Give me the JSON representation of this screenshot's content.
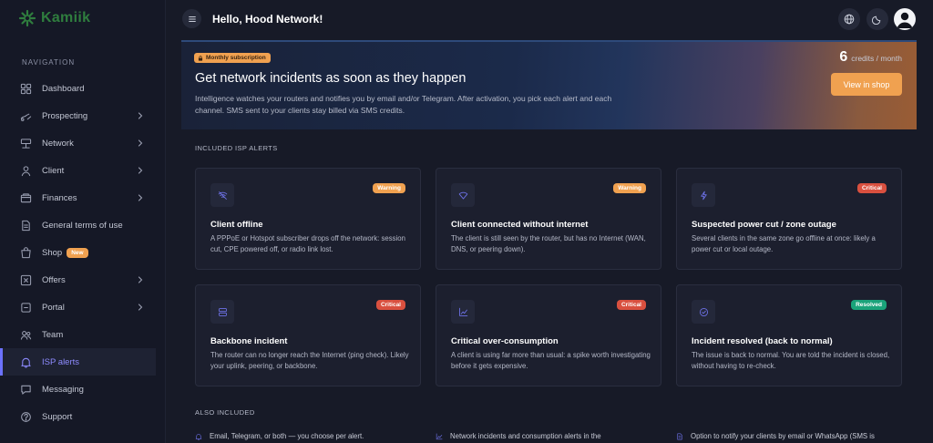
{
  "app": {
    "name": "Kamiik",
    "brand_color": "#2f7d3e",
    "accent": "#6c72ff"
  },
  "header": {
    "greeting": "Hello, Hood Network!"
  },
  "sidebar": {
    "heading": "NAVIGATION",
    "items": [
      {
        "label": "Dashboard",
        "icon": "dashboard-icon",
        "chevron": false
      },
      {
        "label": "Prospecting",
        "icon": "prospecting-icon",
        "chevron": true
      },
      {
        "label": "Network",
        "icon": "network-icon",
        "chevron": true
      },
      {
        "label": "Client",
        "icon": "user-icon",
        "chevron": true
      },
      {
        "label": "Finances",
        "icon": "finances-icon",
        "chevron": true
      },
      {
        "label": "General terms of use",
        "icon": "document-icon",
        "chevron": false
      },
      {
        "label": "Shop",
        "icon": "shop-icon",
        "chevron": false,
        "badge": "New"
      },
      {
        "label": "Offers",
        "icon": "offers-icon",
        "chevron": true
      },
      {
        "label": "Portal",
        "icon": "portal-icon",
        "chevron": true
      },
      {
        "label": "Team",
        "icon": "team-icon",
        "chevron": false
      },
      {
        "label": "ISP alerts",
        "icon": "bell-icon",
        "chevron": false,
        "active": true
      },
      {
        "label": "Messaging",
        "icon": "message-icon",
        "chevron": false
      },
      {
        "label": "Support",
        "icon": "support-icon",
        "chevron": false
      }
    ]
  },
  "banner": {
    "badge": "Monthly subscription",
    "title": "Get network incidents as soon as they happen",
    "description": "Intelligence watches your routers and notifies you by email and/or Telegram. After activation, you pick each alert and each channel. SMS sent to your clients stay billed via SMS credits.",
    "credits_value": "6",
    "credits_unit": "credits / month",
    "cta": "View in shop"
  },
  "included": {
    "heading": "INCLUDED ISP ALERTS",
    "cards": [
      {
        "icon": "wifi-off-icon",
        "badge": "Warning",
        "badge_color": "#f0a150",
        "title": "Client offline",
        "description": "A PPPoE or Hotspot subscriber drops off the network: session cut, CPE powered off, or radio link lost."
      },
      {
        "icon": "wifi-icon",
        "badge": "Warning",
        "badge_color": "#f0a150",
        "title": "Client connected without internet",
        "description": "The client is still seen by the router, but has no Internet (WAN, DNS, or peering down)."
      },
      {
        "icon": "bolt-icon",
        "badge": "Critical",
        "badge_color": "#d9503f",
        "title": "Suspected power cut / zone outage",
        "description": "Several clients in the same zone go offline at once: likely a power cut or local outage."
      },
      {
        "icon": "server-icon",
        "badge": "Critical",
        "badge_color": "#d9503f",
        "title": "Backbone incident",
        "description": "The router can no longer reach the Internet (ping check). Likely your uplink, peering, or backbone."
      },
      {
        "icon": "chart-icon",
        "badge": "Critical",
        "badge_color": "#d9503f",
        "title": "Critical over-consumption",
        "description": "A client is using far more than usual: a spike worth investigating before it gets expensive."
      },
      {
        "icon": "check-circle-icon",
        "badge": "Resolved",
        "badge_color": "#1aa37a",
        "title": "Incident resolved (back to normal)",
        "description": "The issue is back to normal. You are told the incident is closed, without having to re-check."
      }
    ]
  },
  "also_included": {
    "heading": "ALSO INCLUDED",
    "items": [
      {
        "icon": "bell-icon",
        "text": "Email, Telegram, or both — you choose per alert."
      },
      {
        "icon": "chart-icon",
        "text": "Network incidents and consumption alerts in the"
      },
      {
        "icon": "document-icon",
        "text": "Option to notify your clients by email or WhatsApp (SMS is"
      }
    ]
  }
}
